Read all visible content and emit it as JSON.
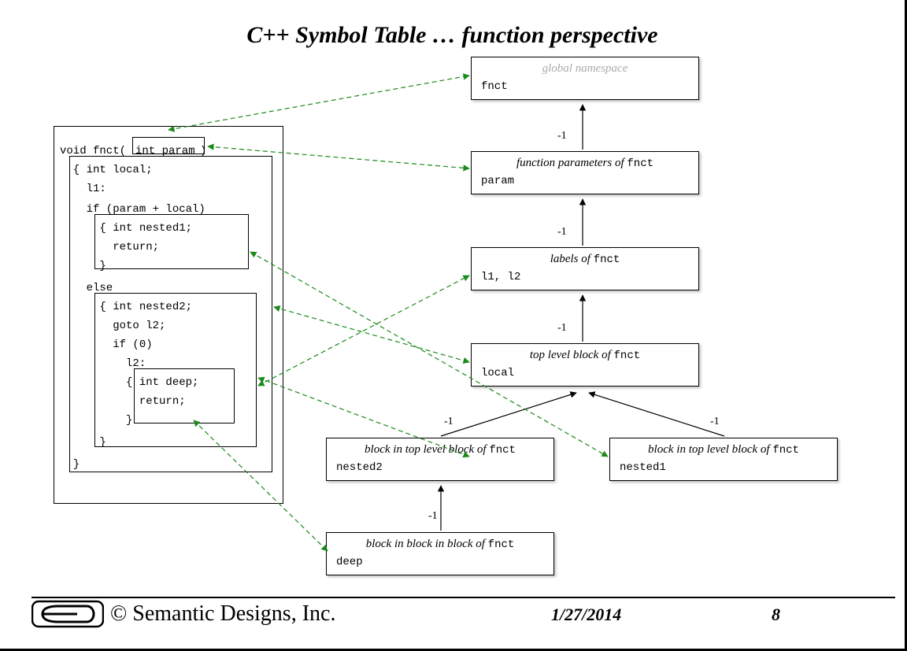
{
  "title": "C++ Symbol Table … function perspective",
  "code": {
    "l1": "void fnct(",
    "param": "int param",
    "l1b": ")",
    "l2": "  { int local;",
    "l3": "    l1:",
    "l4": "    if (param + local)",
    "l5": "      { int nested1;",
    "l6": "        return;",
    "l7": "      }",
    "l8": "    else",
    "l9": "      { int nested2;",
    "l10": "        goto l2;",
    "l11": "        if (0)",
    "l12": "          l2:",
    "l13": "          { int deep;",
    "l14": "            return;",
    "l15": "          }",
    "l16": "      }",
    "l17": "  }"
  },
  "scopes": {
    "global": {
      "title": "global namespace",
      "symbols": "fnct"
    },
    "params": {
      "title_prefix": "function parameters of ",
      "fn": "fnct",
      "symbols": "param"
    },
    "labels": {
      "title_prefix": "labels of ",
      "fn": "fnct",
      "symbols": "l1, l2"
    },
    "top": {
      "title_prefix": "top level block of ",
      "fn": "fnct",
      "symbols": "local"
    },
    "block_n2": {
      "title_prefix": "block in top level block of ",
      "fn": "fnct",
      "symbols": "nested2"
    },
    "block_n1": {
      "title_prefix": "block in top level block of ",
      "fn": "fnct",
      "symbols": "nested1"
    },
    "block_deep": {
      "title_prefix": "block in block in block of ",
      "fn": "fnct",
      "symbols": "deep"
    }
  },
  "edge_labels": {
    "g_p": "-1",
    "p_l": "-1",
    "l_t": "-1",
    "t_n2": "-1",
    "t_n1": "-1",
    "n2_d": "-1"
  },
  "footer": {
    "copyright": "© Semantic Designs, Inc.",
    "date": "1/27/2014",
    "page": "8"
  }
}
